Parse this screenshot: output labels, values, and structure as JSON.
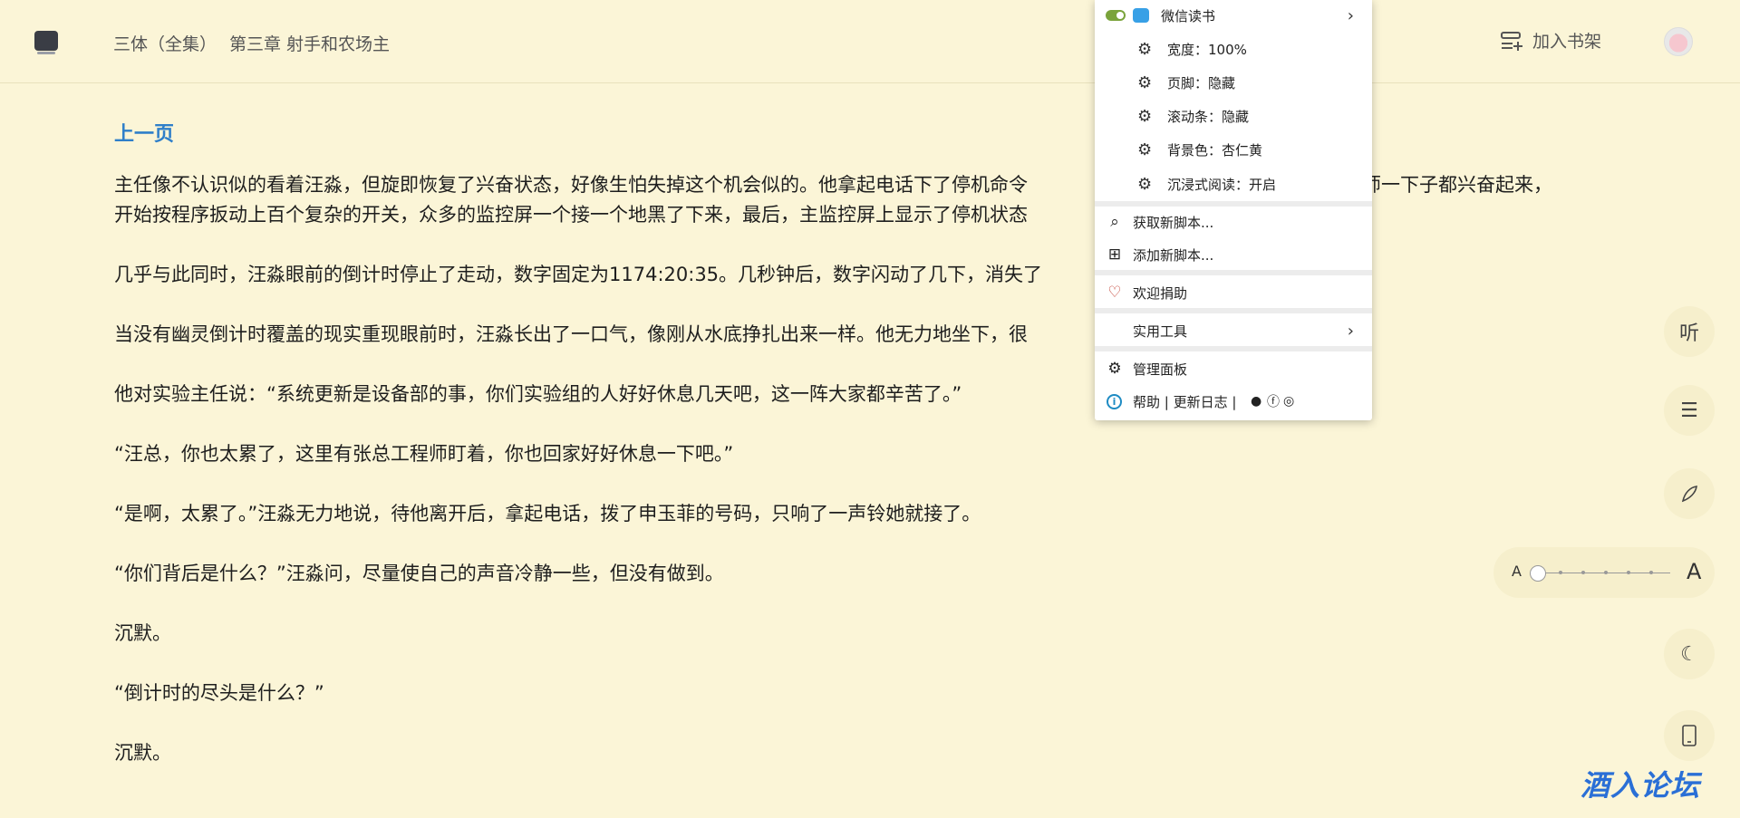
{
  "header": {
    "book_title": "三体（全集）",
    "chapter_title": "第三章 射手和农场主",
    "add_shelf_label": "加入书架"
  },
  "content": {
    "prev_page_label": "上一页",
    "paragraphs": [
      "主任像不认识似的看着汪淼，但旋即恢复了兴奋状态，好像生怕失掉这个机会似的。他拿起电话下了停机命令",
      "加工程师一下子都兴奋起来，",
      "开始按程序扳动上百个复杂的开关，众多的监控屏一个接一个地黑了下来，最后，主监控屏上显示了停机状态",
      "几乎与此同时，汪淼眼前的倒计时停止了走动，数字固定为1174:20:35。几秒钟后，数字闪动了几下，消失了",
      "当没有幽灵倒计时覆盖的现实重现眼前时，汪淼长出了一口气，像刚从水底挣扎出来一样。他无力地坐下，很",
      "他对实验主任说：“系统更新是设备部的事，你们实验组的人好好休息几天吧，这一阵大家都辛苦了。”",
      "“汪总，你也太累了，这里有张总工程师盯着，你也回家好好休息一下吧。”",
      "“是啊，太累了。”汪淼无力地说，待他离开后，拿起电话，拨了申玉菲的号码，只响了一声铃她就接了。",
      "“你们背后是什么？”汪淼问，尽量使自己的声音冷静一些，但没有做到。",
      "沉默。",
      "“倒计时的尽头是什么？”",
      "沉默。"
    ]
  },
  "menu": {
    "script_name": "微信读书",
    "settings": [
      "宽度：100%",
      "页脚：隐藏",
      "滚动条：隐藏",
      "背景色：杏仁黄",
      "沉浸式阅读：开启"
    ],
    "get_scripts": "获取新脚本...",
    "add_script": "添加新脚本...",
    "donate": "欢迎捐助",
    "tools": "实用工具",
    "dashboard": "管理面板",
    "help": "帮助 | 更新日志 |"
  },
  "floating": {
    "listen_label": "听",
    "font_small": "A",
    "font_large": "A",
    "font_size_level": 0
  },
  "watermark": "酒入论坛",
  "colors": {
    "background": "#fbf5d7",
    "link": "#2f7fc9",
    "toggle_on": "#7aa33b"
  }
}
